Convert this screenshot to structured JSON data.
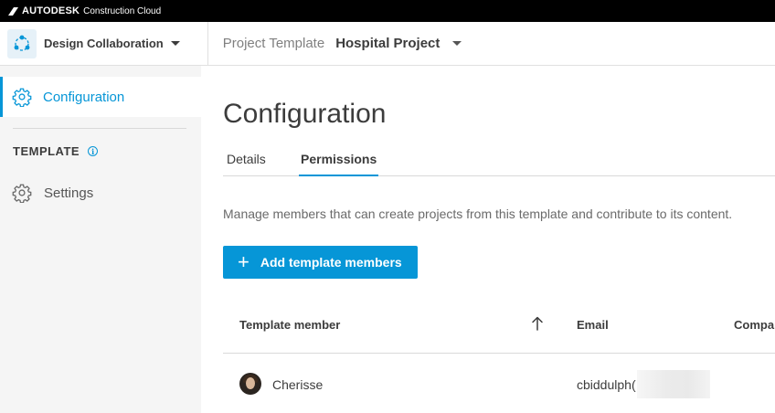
{
  "brand": {
    "name": "AUTODESK",
    "product": "Construction Cloud",
    "accent_color": "#0696d7"
  },
  "header": {
    "product_name": "Design Collaboration",
    "project_label": "Project Template",
    "project_name": "Hospital Project"
  },
  "sidebar": {
    "active_item": {
      "label": "Configuration",
      "icon": "gear-icon"
    },
    "section_title": "TEMPLATE",
    "section_info_glyph": "i",
    "items": [
      {
        "label": "Settings",
        "icon": "gear-icon"
      }
    ]
  },
  "main": {
    "title": "Configuration",
    "tabs": [
      {
        "label": "Details",
        "active": false
      },
      {
        "label": "Permissions",
        "active": true
      }
    ],
    "description": "Manage members that can create projects from this template and contribute to its content.",
    "add_button": {
      "label": "Add template members",
      "icon_glyph": "+"
    },
    "table": {
      "columns": [
        "Template member",
        "Email",
        "Compa"
      ],
      "sort": {
        "column": "Template member",
        "direction": "ascending"
      },
      "rows": [
        {
          "name": "Cherisse",
          "email": "cbiddulph("
        }
      ]
    }
  }
}
